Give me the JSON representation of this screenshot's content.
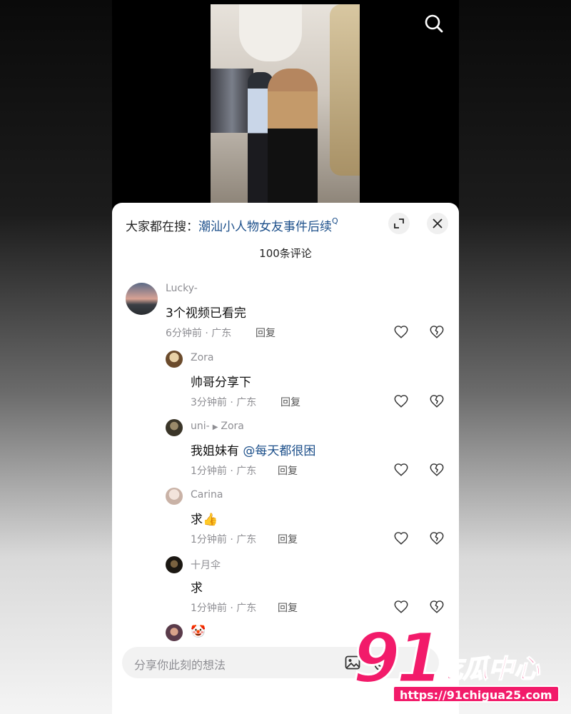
{
  "trending": {
    "prefix": "大家都在搜：",
    "keyword": "潮汕小人物女友事件后续",
    "suffix": "Q"
  },
  "comments_count": "100条评论",
  "comments": [
    {
      "name": "Lucky-",
      "text": "3个视频已看完",
      "meta": "6分钟前 · 广东",
      "reply": "回复"
    },
    {
      "name": "Zora",
      "text": "帅哥分享下",
      "meta": "3分钟前 · 广东",
      "reply": "回复"
    },
    {
      "name": "uni-",
      "reply_to": "Zora",
      "text": "我姐妹有",
      "mention": "@每天都很困",
      "meta": "1分钟前 · 广东",
      "reply": "回复"
    },
    {
      "name": "Carina",
      "text": "求👍",
      "meta": "1分钟前 · 广东",
      "reply": "回复"
    },
    {
      "name": "十月伞",
      "text": "求",
      "meta": "1分钟前 · 广东",
      "reply": "回复"
    },
    {
      "name": "🤡"
    }
  ],
  "input": {
    "placeholder": "分享你此刻的想法"
  },
  "watermark": {
    "number": "91",
    "brand": "吃瓜中心",
    "url": "https://91chigua25.com"
  },
  "colors": {
    "link": "#1c4f8a",
    "meta": "#8e8e93",
    "brand": "#f21b6a"
  }
}
